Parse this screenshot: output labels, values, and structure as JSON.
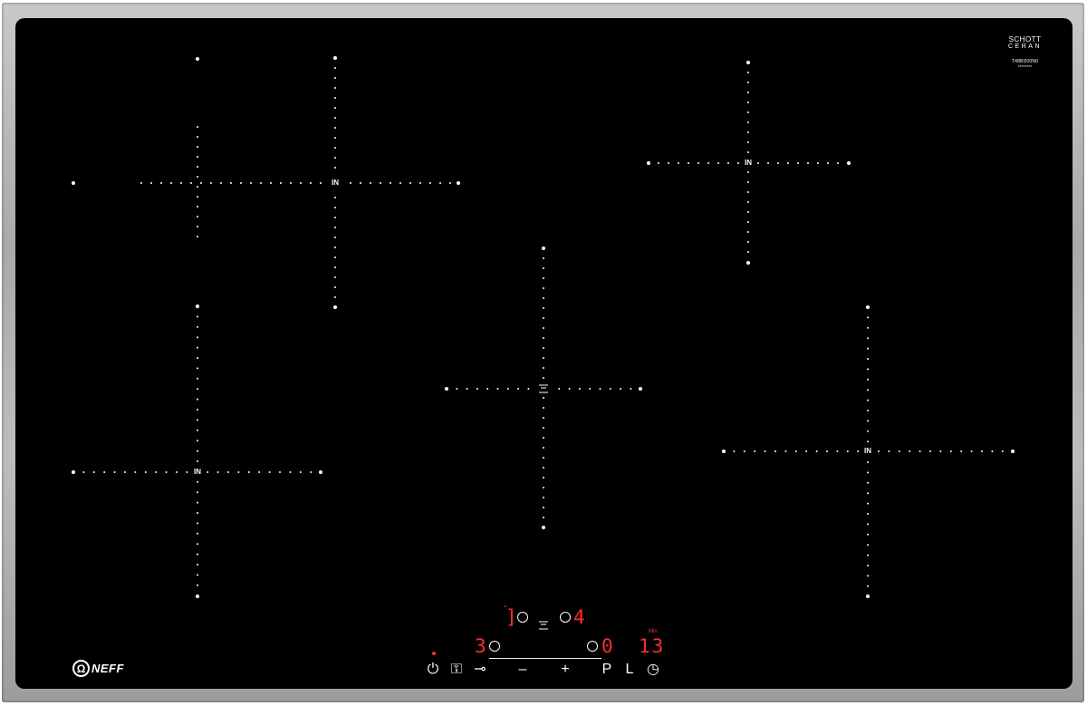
{
  "brand": {
    "logo_word": "NEFF",
    "logo_symbol": "omega"
  },
  "glass_label": {
    "line1": "SCHOTT",
    "line2": "CERAN",
    "code": "T48BD00N0",
    "subcode": "XXXXXXXX"
  },
  "zones": [
    {
      "id": "zone-front-left",
      "label": "IN"
    },
    {
      "id": "zone-rear-left",
      "label": "IN"
    },
    {
      "id": "zone-center",
      "label": "",
      "glyph": "wide-zone-icon"
    },
    {
      "id": "zone-rear-right",
      "label": "IN"
    },
    {
      "id": "zone-front-right",
      "label": "IN"
    }
  ],
  "control_panel": {
    "display_top_left": "]",
    "display_top_right": "4",
    "display_bottom_left": "3",
    "display_bottom_right": "0",
    "timer_unit": "Min",
    "timer_value": "13",
    "indicator_top_left": "=",
    "buttons": [
      {
        "id": "power",
        "icon": "power-icon",
        "label": "⏻"
      },
      {
        "id": "childlock",
        "icon": "childlock-icon",
        "label": "⚿"
      },
      {
        "id": "key",
        "icon": "key-icon",
        "label": "⊸"
      },
      {
        "id": "minus",
        "icon": "minus-icon",
        "label": "–"
      },
      {
        "id": "plus",
        "icon": "plus-icon",
        "label": "+"
      },
      {
        "id": "powerboost",
        "icon": "powerboost-icon",
        "label": "P"
      },
      {
        "id": "l",
        "icon": "l-icon",
        "label": "L"
      },
      {
        "id": "timer",
        "icon": "clock-icon",
        "label": "◷"
      }
    ],
    "led_color": "#ff2b2b"
  },
  "colors": {
    "glass": "#000000",
    "frame": "#b4b4b4",
    "display": "#ff2b2b",
    "markings": "#ffffff"
  }
}
